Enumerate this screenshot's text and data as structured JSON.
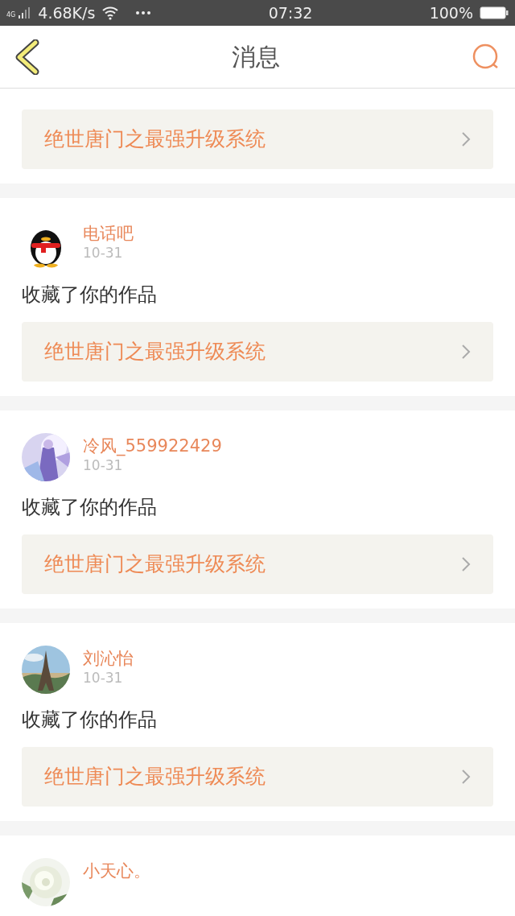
{
  "status_bar": {
    "network": "4G",
    "speed": "4.68K/s",
    "time": "07:32",
    "battery": "100%"
  },
  "header": {
    "title": "消息"
  },
  "messages": [
    {
      "book": "绝世唐门之最强升级系统"
    },
    {
      "avatar": {
        "kind": "penguin"
      },
      "user": "电话吧",
      "date": "10-31",
      "action": "收藏了你的作品",
      "book": "绝世唐门之最强升级系统"
    },
    {
      "user": "冷风_559922429",
      "date": "10-31",
      "action": "收藏了你的作品",
      "book": "绝世唐门之最强升级系统"
    },
    {
      "user": "刘沁怡",
      "date": "10-31",
      "action": "收藏了你的作品",
      "book": "绝世唐门之最强升级系统"
    },
    {
      "user": "小天心。"
    }
  ]
}
